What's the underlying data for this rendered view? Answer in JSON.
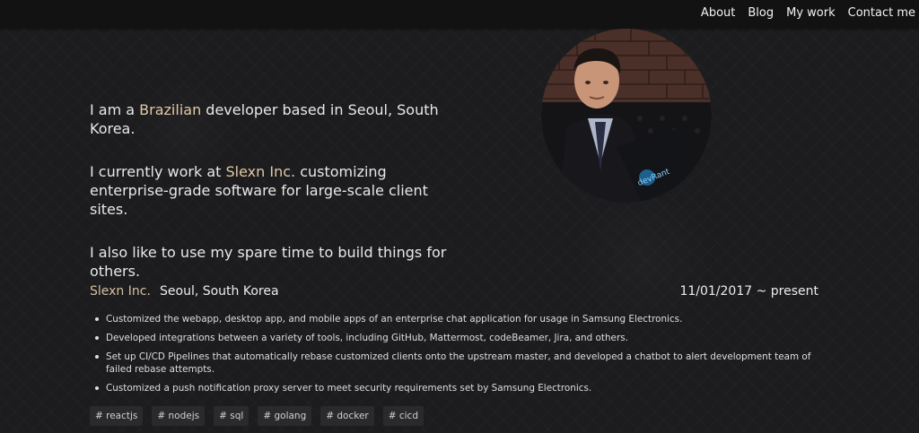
{
  "nav": {
    "about": "About",
    "blog": "Blog",
    "work": "My work",
    "contact": "Contact me"
  },
  "intro": {
    "p1_pre": "I am a ",
    "p1_accent": "Brazilian",
    "p1_post": " developer based in Seoul, South Korea.",
    "p2_pre": "I currently work at ",
    "p2_accent": "Slexn Inc.",
    "p2_post": " customizing enterprise-grade software for large-scale client sites.",
    "p3": "I also like to use my spare time to build things for others."
  },
  "avatar": {
    "icon": "profile-photo",
    "laptop_sticker": "devRant"
  },
  "job": {
    "company": "Slexn Inc.",
    "location": "Seoul, South Korea",
    "dates": "11/01/2017 ~ present",
    "bullets": [
      "Customized the webapp, desktop app, and mobile apps of an enterprise chat application for usage in Samsung Electronics.",
      "Developed integrations between a variety of tools, including GitHub, Mattermost, codeBeamer, Jira, and others.",
      "Set up CI/CD Pipelines that automatically rebase customized clients onto the upstream master, and developed a chatbot to alert development team of failed rebase attempts.",
      "Customized a push notification proxy server to meet security requirements set by Samsung Electronics."
    ],
    "tags": [
      "# reactjs",
      "# nodejs",
      "# sql",
      "# golang",
      "# docker",
      "# cicd"
    ]
  },
  "colors": {
    "background": "#1c1c1e",
    "topbar": "#121212",
    "accent": "#e2c9a4",
    "text": "#e8e8e8",
    "tag_bg": "#2a2a2c"
  }
}
